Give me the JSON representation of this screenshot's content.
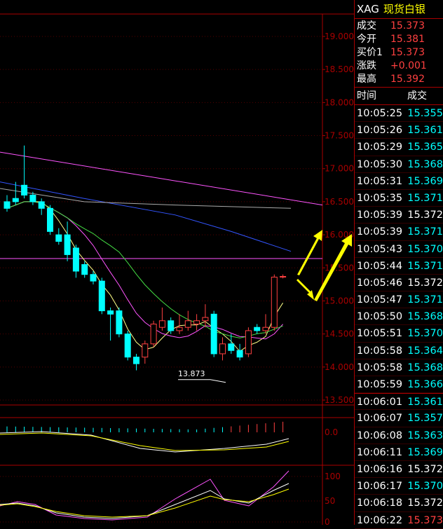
{
  "header": {
    "symbol": "XAG",
    "name": "现货白银"
  },
  "quote": [
    {
      "label": "成交",
      "value": "15.373"
    },
    {
      "label": "今开",
      "value": "15.381"
    },
    {
      "label": "买价1",
      "value": "15.373"
    },
    {
      "label": "涨跌",
      "value": "+0.001"
    },
    {
      "label": "最高",
      "value": "15.392"
    }
  ],
  "ticks_header": {
    "time": "时间",
    "price": "成交"
  },
  "ticks": [
    {
      "time": "10:05:25",
      "price": "15.355",
      "dir": "dn"
    },
    {
      "time": "10:05:26",
      "price": "15.361",
      "dir": "dn"
    },
    {
      "time": "10:05:29",
      "price": "15.365",
      "dir": "dn"
    },
    {
      "time": "10:05:30",
      "price": "15.368",
      "dir": "dn"
    },
    {
      "time": "10:05:31",
      "price": "15.369",
      "dir": "dn"
    },
    {
      "time": "10:05:35",
      "price": "15.371",
      "dir": "dn"
    },
    {
      "time": "10:05:39",
      "price": "15.372",
      "dir": "fl"
    },
    {
      "time": "10:05:39",
      "price": "15.371",
      "dir": "dn"
    },
    {
      "time": "10:05:43",
      "price": "15.370",
      "dir": "dn"
    },
    {
      "time": "10:05:44",
      "price": "15.371",
      "dir": "dn"
    },
    {
      "time": "10:05:46",
      "price": "15.372",
      "dir": "fl"
    },
    {
      "time": "10:05:47",
      "price": "15.371",
      "dir": "dn"
    },
    {
      "time": "10:05:50",
      "price": "15.368",
      "dir": "dn"
    },
    {
      "time": "10:05:51",
      "price": "15.370",
      "dir": "dn"
    },
    {
      "time": "10:05:58",
      "price": "15.364",
      "dir": "dn"
    },
    {
      "time": "10:05:58",
      "price": "15.368",
      "dir": "dn"
    },
    {
      "time": "10:05:59",
      "price": "15.366",
      "dir": "dn"
    },
    {
      "time": "10:06:01",
      "price": "15.361",
      "dir": "dn"
    },
    {
      "time": "10:06:07",
      "price": "15.357",
      "dir": "dn"
    },
    {
      "time": "10:06:08",
      "price": "15.363",
      "dir": "dn"
    },
    {
      "time": "10:06:11",
      "price": "15.369",
      "dir": "dn"
    },
    {
      "time": "10:06:16",
      "price": "15.372",
      "dir": "fl"
    },
    {
      "time": "10:06:17",
      "price": "15.370",
      "dir": "dn"
    },
    {
      "time": "10:06:18",
      "price": "15.372",
      "dir": "fl"
    },
    {
      "time": "10:06:22",
      "price": "15.373",
      "dir": "up"
    }
  ],
  "colors": {
    "up": "#ff4040",
    "down": "#00ffff",
    "grid": "#aa0000",
    "accent": "#ffff00"
  },
  "chart_data": {
    "type": "candlestick",
    "y_ticks": [
      "19.000",
      "18.500",
      "18.000",
      "17.500",
      "17.000",
      "16.500",
      "16.000",
      "15.500",
      "15.000",
      "14.500",
      "14.000",
      "13.500"
    ],
    "ylim": [
      13.5,
      19.0
    ],
    "low_annotation": "13.873",
    "candles": [
      [
        16.5,
        16.6,
        16.35,
        16.4
      ],
      [
        16.55,
        16.8,
        16.45,
        16.5
      ],
      [
        16.75,
        17.35,
        16.55,
        16.6
      ],
      [
        16.6,
        16.65,
        16.45,
        16.5
      ],
      [
        16.5,
        16.55,
        16.3,
        16.4
      ],
      [
        16.4,
        16.45,
        16.0,
        16.05
      ],
      [
        16.0,
        16.1,
        15.85,
        15.9
      ],
      [
        16.0,
        16.2,
        15.6,
        15.7
      ],
      [
        15.8,
        15.85,
        15.35,
        15.45
      ],
      [
        15.55,
        15.6,
        15.35,
        15.4
      ],
      [
        15.4,
        15.45,
        15.25,
        15.3
      ],
      [
        15.3,
        15.35,
        14.8,
        14.85
      ],
      [
        14.85,
        14.9,
        14.4,
        14.8
      ],
      [
        14.85,
        14.9,
        14.45,
        14.5
      ],
      [
        14.5,
        14.55,
        14.1,
        14.15
      ],
      [
        14.15,
        14.2,
        13.95,
        14.05
      ],
      [
        14.15,
        14.4,
        14.05,
        14.35
      ],
      [
        14.35,
        14.7,
        14.3,
        14.65
      ],
      [
        14.6,
        14.9,
        14.55,
        14.7
      ],
      [
        14.7,
        14.75,
        14.5,
        14.55
      ],
      [
        14.55,
        14.8,
        14.5,
        14.6
      ],
      [
        14.6,
        14.85,
        14.55,
        14.7
      ],
      [
        14.65,
        14.8,
        14.55,
        14.7
      ],
      [
        14.7,
        14.95,
        14.6,
        14.75
      ],
      [
        14.8,
        14.85,
        14.15,
        14.2
      ],
      [
        14.2,
        14.45,
        14.1,
        14.35
      ],
      [
        14.35,
        14.5,
        14.2,
        14.25
      ],
      [
        14.25,
        14.35,
        14.1,
        14.15
      ],
      [
        14.2,
        14.6,
        14.15,
        14.55
      ],
      [
        14.6,
        14.65,
        14.5,
        14.55
      ],
      [
        14.55,
        14.8,
        14.5,
        14.6
      ],
      [
        14.6,
        15.4,
        14.55,
        15.36
      ],
      [
        15.36,
        15.4,
        15.34,
        15.37
      ]
    ],
    "ma_lines": [
      {
        "color": "#ff55ff",
        "values": [
          17.2,
          16.4
        ]
      },
      {
        "color": "#3355ff",
        "values": [
          16.65,
          15.75
        ]
      },
      {
        "color": "#aaaaaa",
        "values": [
          16.55,
          16.4
        ]
      }
    ],
    "macd_zero_label": "0.0",
    "kdj_ticks": [
      "100",
      "50",
      "0"
    ]
  }
}
